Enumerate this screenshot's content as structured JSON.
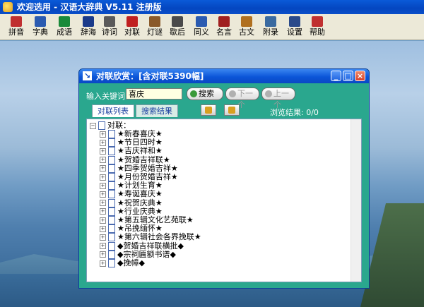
{
  "window": {
    "title": "欢迎选用 - 汉语大辞典 V5.11 注册版"
  },
  "toolbar": {
    "items": [
      {
        "label": "拼音",
        "color": "#c03030"
      },
      {
        "label": "字典",
        "color": "#2a5ab0"
      },
      {
        "label": "成语",
        "color": "#1a8a3a"
      },
      {
        "label": "辞海",
        "color": "#1a3a8a"
      },
      {
        "label": "诗词",
        "color": "#5a5a5a"
      },
      {
        "label": "对联",
        "color": "#c02020"
      },
      {
        "label": "灯谜",
        "color": "#8a5a2a"
      },
      {
        "label": "歇后",
        "color": "#4a4a4a"
      },
      {
        "label": "同义",
        "color": "#2a5ab0"
      },
      {
        "label": "名言",
        "color": "#a02020"
      },
      {
        "label": "古文",
        "color": "#b07020"
      },
      {
        "label": "附录",
        "color": "#3a6aa0"
      },
      {
        "label": "设置",
        "color": "#2a4a8a"
      },
      {
        "label": "帮助",
        "color": "#c03030"
      }
    ]
  },
  "dialog": {
    "title": "对联欣赏：[含对联5390幅]",
    "keyword_label": "输入关键词",
    "keyword_value": "喜庆",
    "search_button": "搜索",
    "next_button": "下一个",
    "prev_button": "上一个",
    "tab_list": "对联列表",
    "tab_results": "搜索结果",
    "stats": "浏览结果: 0/0",
    "tree_root": "对联：",
    "tree_items": [
      "★新春喜庆★",
      "★节日四时★",
      "★吉庆祥和★",
      "★贺婚吉祥联★",
      "★四季贺婚吉祥★",
      "★月份贺婚吉祥★",
      "★计划生育★",
      "★寿诞喜庆★",
      "★祝贺庆典★",
      "★行业庆典★",
      "★第五辑文化艺苑联★",
      "★吊挽缅怀★",
      "★第六辑社会各界挽联★",
      "◆贺婚吉祥联横批◆",
      "◆宗祠匾额书谱◆",
      "◆挽幛◆"
    ]
  }
}
